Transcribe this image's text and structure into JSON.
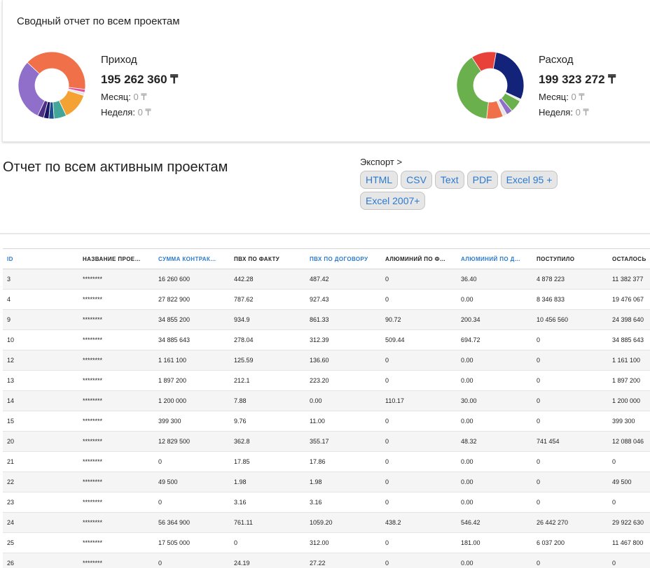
{
  "summary": {
    "title": "Сводный отчет по всем проектам",
    "income": {
      "label": "Приход",
      "amount": "195 262 360 ₸",
      "month_label": "Месяц:",
      "month_value": "0 ₸",
      "week_label": "Неделя:",
      "week_value": "0 ₸",
      "chart_data": {
        "type": "pie",
        "values": [
          40,
          1.5,
          1.5,
          13,
          6,
          2.5,
          2.5,
          3,
          30
        ],
        "colors": [
          "#f0704a",
          "#e74c9c",
          "#e6e6e6",
          "#f4a233",
          "#43a69b",
          "#1f4e8c",
          "#1b1464",
          "#4b2f84",
          "#8f6fc9"
        ]
      }
    },
    "expense": {
      "label": "Расход",
      "amount": "199 323 272 ₸",
      "month_label": "Месяц:",
      "month_value": "0 ₸",
      "week_label": "Неделя:",
      "week_value": "0 ₸",
      "chart_data": {
        "type": "pie",
        "values": [
          29,
          1,
          6,
          3,
          2,
          8,
          39,
          12
        ],
        "colors": [
          "#14237a",
          "#e6e6e6",
          "#6ab04c",
          "#8f6fc9",
          "#e6e6e6",
          "#f0704a",
          "#6ab04c",
          "#e8413a"
        ]
      }
    }
  },
  "report": {
    "title": "Отчет по всем активным проектам",
    "export_label": "Экспорт >",
    "export_buttons": [
      "HTML",
      "CSV",
      "Text",
      "PDF",
      "Excel 95 +",
      "Excel 2007+"
    ]
  },
  "table": {
    "columns": [
      {
        "label": "ID",
        "sortable": true
      },
      {
        "label": "НАЗВАНИЕ ПРОЕ…",
        "sortable": false
      },
      {
        "label": "СУММА КОНТРАК…",
        "sortable": true
      },
      {
        "label": "ПВХ ПО ФАКТУ",
        "sortable": false
      },
      {
        "label": "ПВХ ПО ДОГОВОРУ",
        "sortable": true
      },
      {
        "label": "АЛЮМИНИЙ ПО Ф…",
        "sortable": false
      },
      {
        "label": "АЛЮМИНИЙ ПО Д…",
        "sortable": true
      },
      {
        "label": "ПОСТУПИЛО",
        "sortable": false
      },
      {
        "label": "ОСТАЛОСЬ",
        "sortable": false
      }
    ],
    "rows": [
      [
        "3",
        "********",
        "16 260 600",
        "442.28",
        "487.42",
        "0",
        "36.40",
        "4 878 223",
        "11 382 377"
      ],
      [
        "4",
        "********",
        "27 822 900",
        "787.62",
        "927.43",
        "0",
        "0.00",
        "8 346 833",
        "19 476 067"
      ],
      [
        "9",
        "********",
        "34 855 200",
        "934.9",
        "861.33",
        "90.72",
        "200.34",
        "10 456 560",
        "24 398 640"
      ],
      [
        "10",
        "********",
        "34 885 643",
        "278.04",
        "312.39",
        "509.44",
        "694.72",
        "0",
        "34 885 643"
      ],
      [
        "12",
        "********",
        "1 161 100",
        "125.59",
        "136.60",
        "0",
        "0.00",
        "0",
        "1 161 100"
      ],
      [
        "13",
        "********",
        "1 897 200",
        "212.1",
        "223.20",
        "0",
        "0.00",
        "0",
        "1 897 200"
      ],
      [
        "14",
        "********",
        "1 200 000",
        "7.88",
        "0.00",
        "110.17",
        "30.00",
        "0",
        "1 200 000"
      ],
      [
        "15",
        "********",
        "399 300",
        "9.76",
        "11.00",
        "0",
        "0.00",
        "0",
        "399 300"
      ],
      [
        "20",
        "********",
        "12 829 500",
        "362.8",
        "355.17",
        "0",
        "48.32",
        "741 454",
        "12 088 046"
      ],
      [
        "21",
        "********",
        "0",
        "17.85",
        "17.86",
        "0",
        "0.00",
        "0",
        "0"
      ],
      [
        "22",
        "********",
        "49 500",
        "1.98",
        "1.98",
        "0",
        "0.00",
        "0",
        "49 500"
      ],
      [
        "23",
        "********",
        "0",
        "3.16",
        "3.16",
        "0",
        "0.00",
        "0",
        "0"
      ],
      [
        "24",
        "********",
        "56 364 900",
        "761.11",
        "1059.20",
        "438.2",
        "546.42",
        "26 442 270",
        "29 922 630"
      ],
      [
        "25",
        "********",
        "17 505 000",
        "0",
        "312.00",
        "0",
        "181.00",
        "6 037 200",
        "11 467 800"
      ],
      [
        "26",
        "********",
        "0",
        "24.19",
        "27.22",
        "0",
        "0.00",
        "0",
        "0"
      ]
    ]
  }
}
